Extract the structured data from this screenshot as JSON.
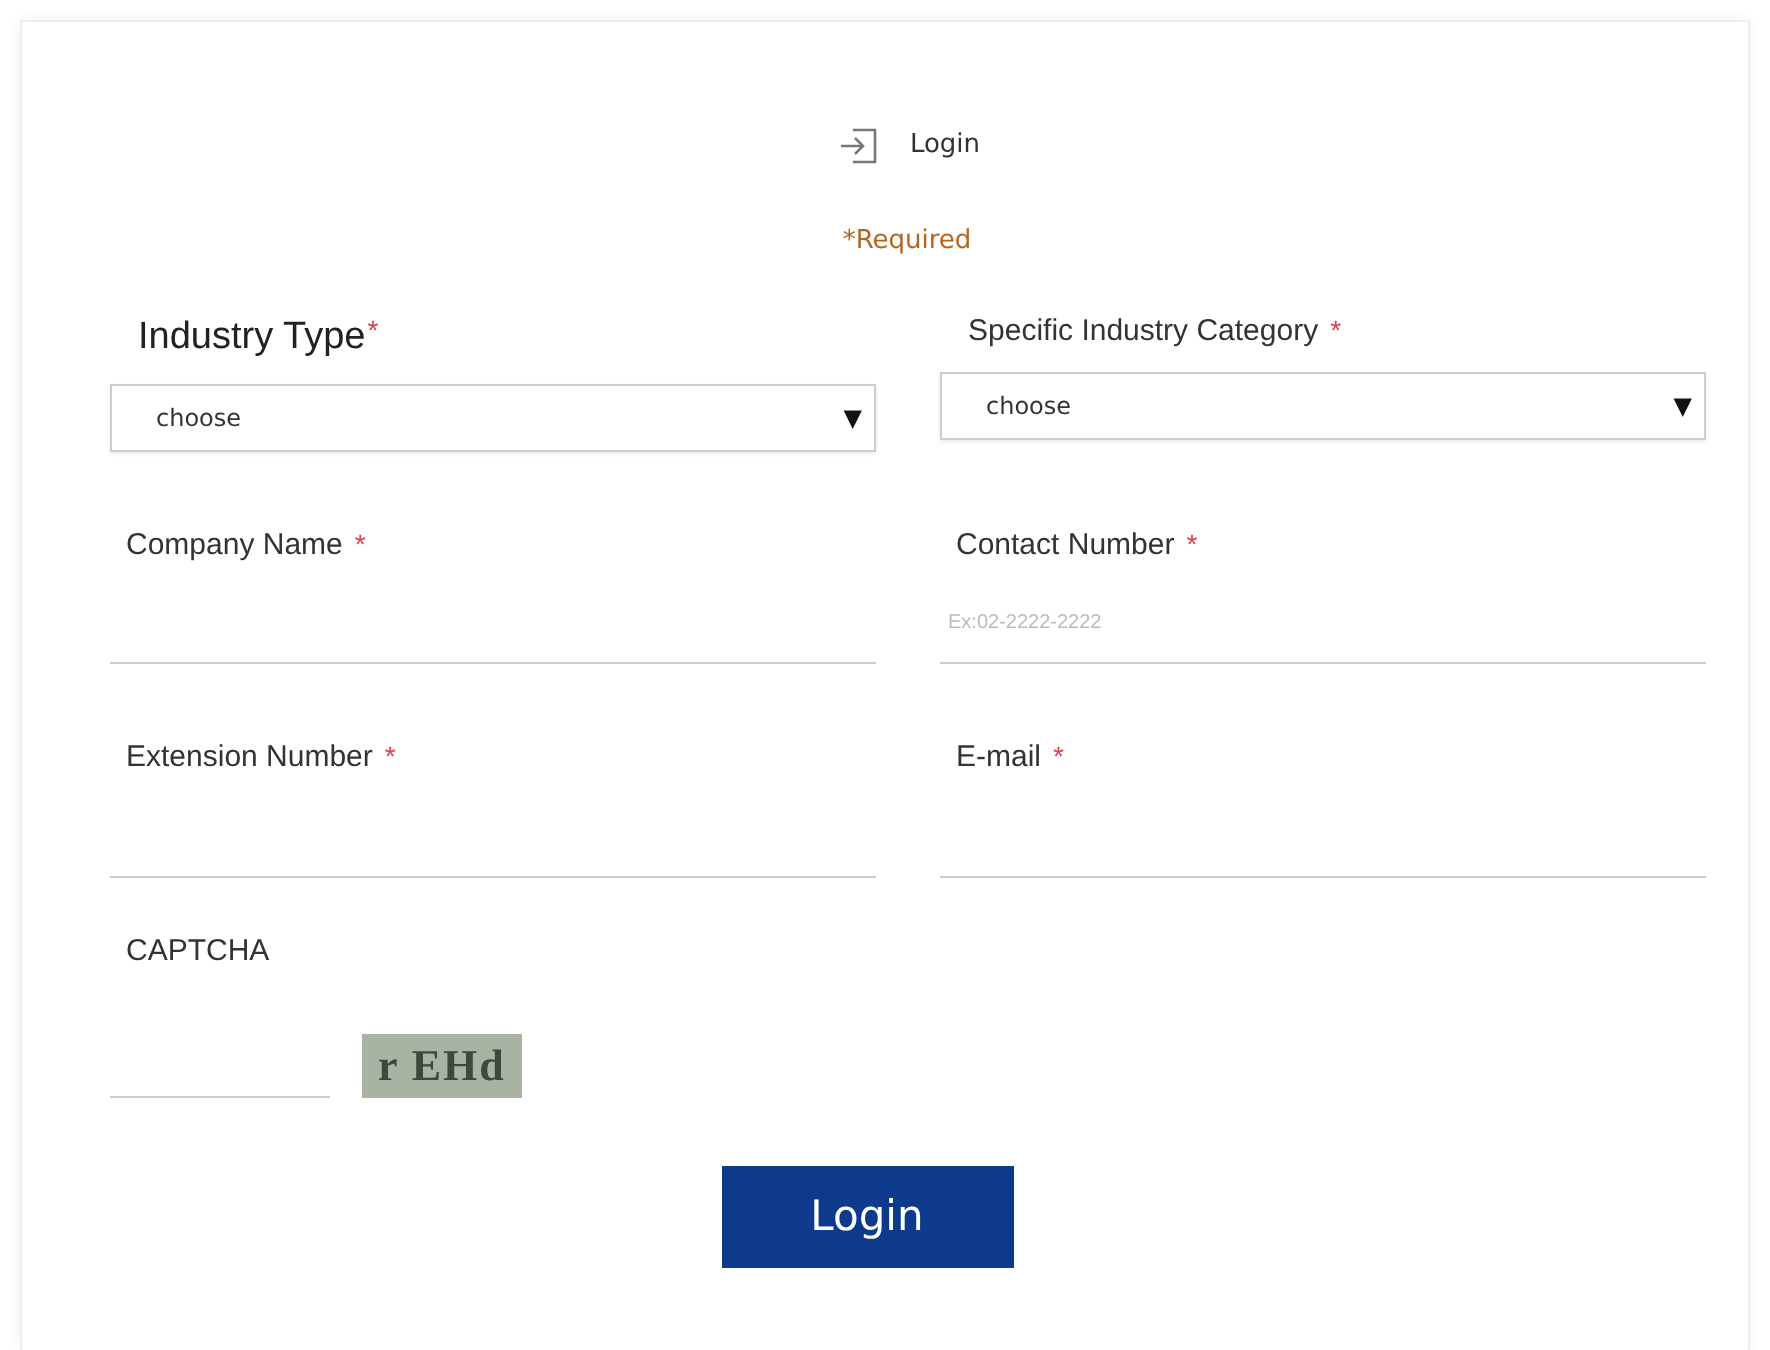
{
  "header": {
    "title": "Login"
  },
  "required_note": "*Required",
  "fields": [
    {
      "kind": "select",
      "label": "Industry Type",
      "asterisk": "*",
      "large": true,
      "value": "choose",
      "caret": "▼"
    },
    {
      "kind": "select",
      "label": "Specific Industry Category",
      "asterisk": "*",
      "large": false,
      "value": "choose",
      "caret": "▼"
    },
    {
      "kind": "text",
      "label": "Company Name",
      "asterisk": "*",
      "large": false
    },
    {
      "kind": "text",
      "label": "Contact Number",
      "asterisk": "*",
      "large": false,
      "placeholder": "Ex:02-2222-2222"
    },
    {
      "kind": "text",
      "label": "Extension Number",
      "asterisk": "*",
      "large": false
    },
    {
      "kind": "text",
      "label": "E-mail",
      "asterisk": "*",
      "large": false
    }
  ],
  "captcha": {
    "label": "CAPTCHA",
    "code": "r EHd"
  },
  "submit": "Login"
}
